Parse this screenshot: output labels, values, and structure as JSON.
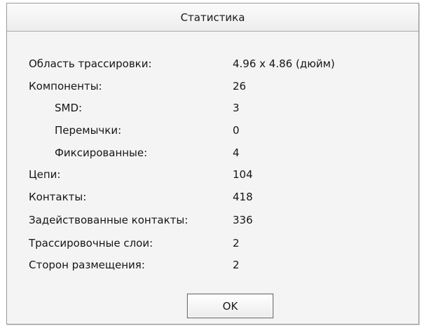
{
  "dialog": {
    "title": "Статистика",
    "rows": [
      {
        "label": "Область трассировки:",
        "value": "4.96 x 4.86 (дюйм)"
      },
      {
        "label": "Компоненты:",
        "value": "26"
      },
      {
        "label": "SMD:",
        "value": "3"
      },
      {
        "label": "Перемычки:",
        "value": "0"
      },
      {
        "label": "Фиксированные:",
        "value": "4"
      },
      {
        "label": "Цепи:",
        "value": "104"
      },
      {
        "label": "Контакты:",
        "value": "418"
      },
      {
        "label": "Задействованные контакты:",
        "value": "336"
      },
      {
        "label": "Трассировочные слои:",
        "value": "2"
      },
      {
        "label": "Сторон размещения:",
        "value": "2"
      }
    ],
    "ok_label": "OK"
  }
}
